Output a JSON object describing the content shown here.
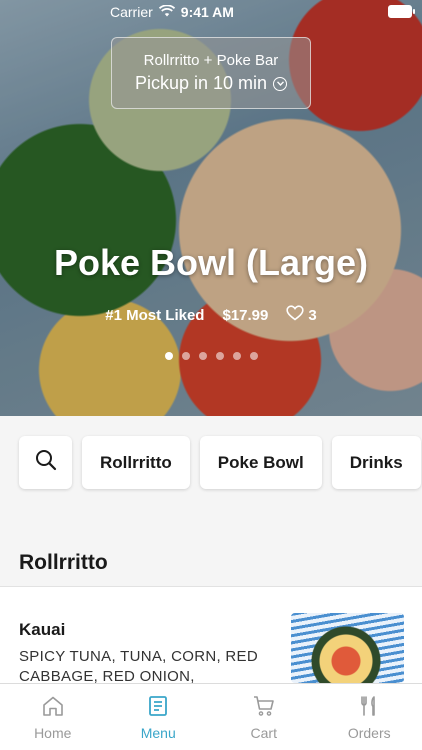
{
  "status_bar": {
    "carrier": "Carrier",
    "time": "9:41 AM"
  },
  "pickup": {
    "store": "Rollrritto + Poke Bar",
    "time_text": "Pickup in 10 min"
  },
  "hero": {
    "title": "Poke Bowl (Large)",
    "rank": "#1 Most Liked",
    "price": "$17.99",
    "likes": "3",
    "carousel_pages": 6,
    "carousel_active_index": 0
  },
  "categories": {
    "search_icon": "search-icon",
    "items": [
      "Rollrritto",
      "Poke Bowl",
      "Drinks"
    ]
  },
  "section": {
    "title": "Rollrritto",
    "items": [
      {
        "name": "Kauai",
        "description": "SPICY TUNA, TUNA, CORN, RED CABBAGE, RED ONION, CARROT..."
      }
    ]
  },
  "tabbar": {
    "tabs": [
      {
        "label": "Home",
        "icon": "home-icon"
      },
      {
        "label": "Menu",
        "icon": "menu-icon"
      },
      {
        "label": "Cart",
        "icon": "cart-icon"
      },
      {
        "label": "Orders",
        "icon": "orders-icon"
      }
    ],
    "active_index": 1
  },
  "colors": {
    "accent": "#3aa6c9",
    "inactive": "#9a9a9a"
  }
}
